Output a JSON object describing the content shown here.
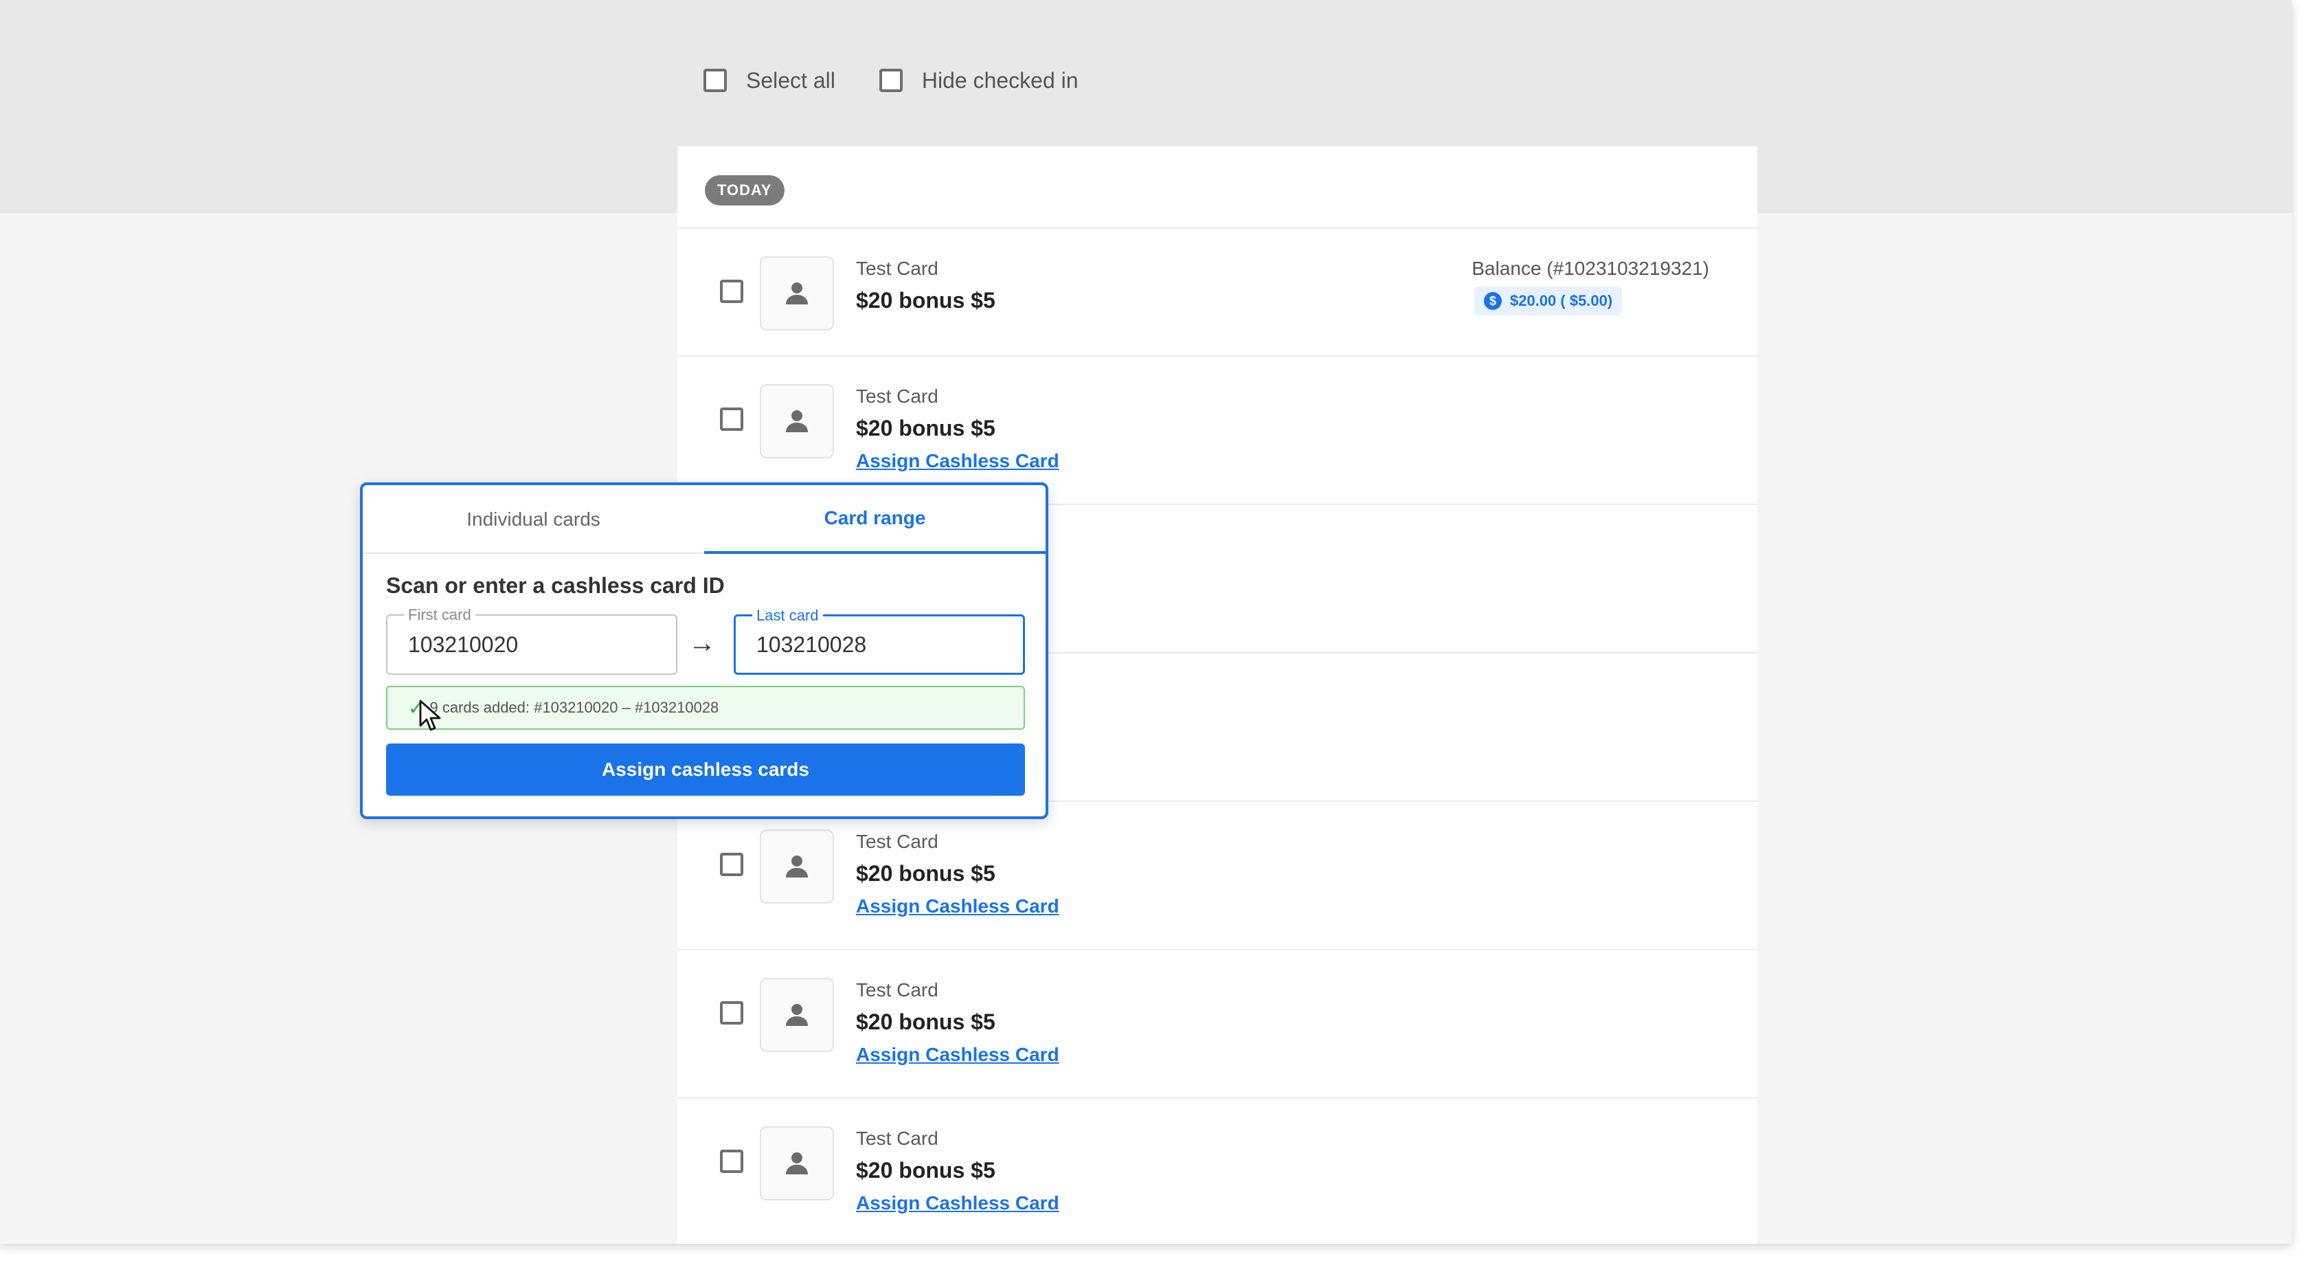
{
  "toolbar": {
    "select_all_label": "Select all",
    "hide_checked_in_label": "Hide checked in"
  },
  "list": {
    "date_badge": "TODAY",
    "rows": [
      {
        "subtitle": "Test Card",
        "title": "$20 bonus $5",
        "balance_label": "Balance (#1023103219321)",
        "balance_value": "$20.00 ( $5.00)",
        "balance_icon": "dollar-coin-icon"
      },
      {
        "subtitle": "Test Card",
        "title": "$20 bonus $5",
        "link": "Assign Cashless Card"
      },
      {
        "subtitle": "Test Card",
        "title": "$20 bonus $5",
        "link": "Assign Cashless Card"
      },
      {
        "subtitle": "Test Card",
        "title": "$20 bonus $5",
        "link": "Assign Cashless Card"
      },
      {
        "subtitle": "Test Card",
        "title": "$20 bonus $5",
        "link": "Assign Cashless Card"
      }
    ]
  },
  "popup": {
    "tabs": [
      {
        "label": "Individual cards",
        "active": false
      },
      {
        "label": "Card range",
        "active": true
      }
    ],
    "heading": "Scan or enter a cashless card ID",
    "first_card": {
      "label": "First card",
      "value": "103210020"
    },
    "last_card": {
      "label": "Last card",
      "value": "103210028"
    },
    "arrow": "→",
    "success_message": "9 cards added: #103210020 – #103210028",
    "submit_label": "Assign cashless cards"
  },
  "colors": {
    "accent": "#1a73e8",
    "success_bg": "#eefbef",
    "success_border": "#7bd17b",
    "badge": "#7b7b7b"
  },
  "icons": [
    "person-icon",
    "checkmark-icon",
    "arrow-right-icon",
    "cursor-icon"
  ]
}
